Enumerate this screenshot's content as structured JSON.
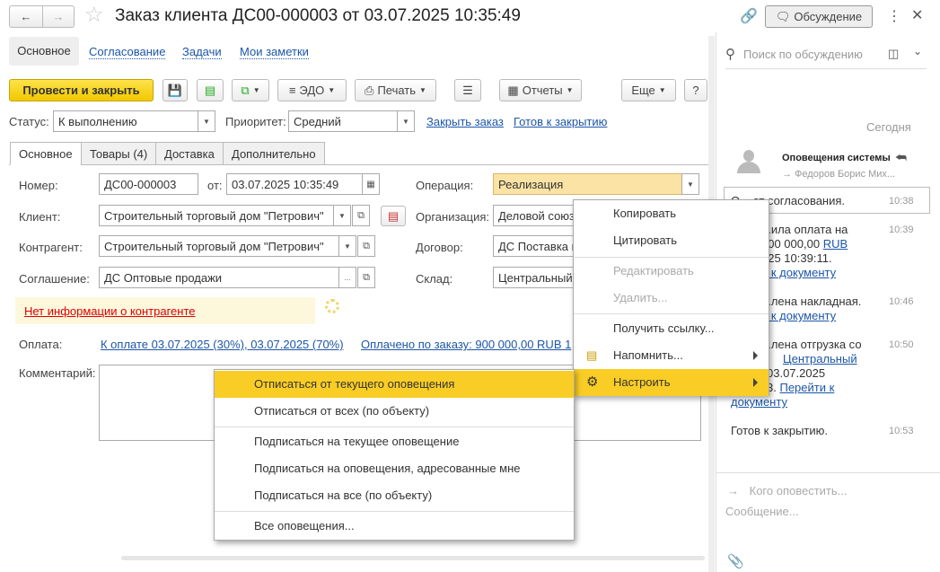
{
  "window": {
    "title": "Заказ клиента ДС00-000003 от 03.07.2025 10:35:49",
    "discussion_button": "Обсуждение"
  },
  "nav_tabs": [
    "Основное",
    "Согласование",
    "Задачи",
    "Мои заметки"
  ],
  "toolbar": {
    "post_close": "Провести и закрыть",
    "edo": "ЭДО",
    "print": "Печать",
    "reports": "Отчеты",
    "more": "Еще",
    "help": "?"
  },
  "status": {
    "label": "Статус:",
    "value": "К выполнению",
    "priority_label": "Приоритет:",
    "priority_value": "Средний",
    "close_order": "Закрыть заказ",
    "ready_to_close": "Готов к закрытию"
  },
  "form_tabs": [
    "Основное",
    "Товары (4)",
    "Доставка",
    "Дополнительно"
  ],
  "fields": {
    "number_label": "Номер:",
    "number": "ДС00-000003",
    "date_label": "от:",
    "date": "03.07.2025 10:35:49",
    "operation_label": "Операция:",
    "operation": "Реализация",
    "client_label": "Клиент:",
    "client": "Строительный торговый дом \"Петрович\"",
    "org_label": "Организация:",
    "org": "Деловой союз",
    "counterparty_label": "Контрагент:",
    "counterparty": "Строительный торговый дом \"Петрович\"",
    "contract_label": "Договор:",
    "contract": "ДС Поставка и",
    "agreement_label": "Соглашение:",
    "agreement": "ДС Оптовые продажи",
    "warehouse_label": "Склад:",
    "warehouse": "Центральный",
    "no_info": "Нет информации о контрагенте",
    "payment_label": "Оплата:",
    "payment_schedule": "К оплате 03.07.2025 (30%), 03.07.2025 (70%)",
    "paid": "Оплачено по заказу: 900 000,00 RUB 1",
    "comment_label": "Комментарий:"
  },
  "context_menu": [
    {
      "label": "Копировать",
      "disabled": false
    },
    {
      "label": "Цитировать",
      "disabled": false
    },
    {
      "label": "Редактировать",
      "disabled": true
    },
    {
      "label": "Удалить...",
      "disabled": true
    },
    {
      "label": "Получить ссылку...",
      "disabled": false
    },
    {
      "label": "Напомнить...",
      "disabled": false,
      "submenu": true
    },
    {
      "label": "Настроить",
      "disabled": false,
      "submenu": true,
      "highlighted": true
    }
  ],
  "submenu": [
    "Отписаться от текущего оповещения",
    "Отписаться от всех (по объекту)",
    "Подписаться на текущее оповещение",
    "Подписаться на оповещения, адресованные мне",
    "Подписаться на все (по объекту)",
    "Все оповещения..."
  ],
  "discussion": {
    "search_placeholder": "Поиск по обсуждению",
    "day": "Сегодня",
    "sender": "Оповещения системы",
    "recipient": "→ Федоров Борис Мих...",
    "messages": [
      {
        "text": "О... ет согласования.",
        "time": "10:38"
      },
      {
        "l1": "...ила оплата на",
        "l2": "900 000,00 ",
        "l2link": "RUB",
        "l3": "025 10:39:11.",
        "l4link": "и к документу",
        "time": "10:39"
      },
      {
        "l1": "...лена накладная.",
        "l2link": "и к документу",
        "time": "10:46"
      },
      {
        "l1": "...лена отгрузка со",
        "l2link": "Центральный",
        "l3": "03.07.2025",
        "l4": "3. ",
        "l4link": "Перейти к",
        "l5link": "документу",
        "time": "10:50"
      },
      {
        "text": "Готов к закрытию.",
        "time": "10:53"
      }
    ],
    "notify_placeholder": "Кого оповестить...",
    "message_placeholder": "Сообщение..."
  },
  "colors": {
    "accent": "#f9cd25",
    "link": "#1c56a8",
    "warning_bg": "#fdf7dc"
  }
}
